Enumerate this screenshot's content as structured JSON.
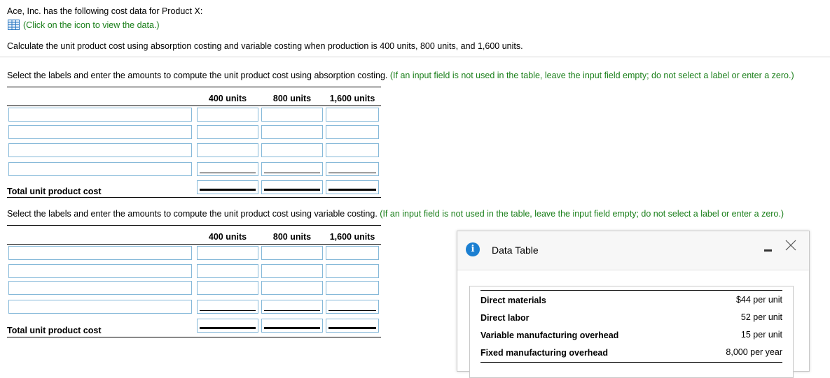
{
  "intro_text": "Ace, Inc. has the following cost data for Product X:",
  "icon_link_text": "(Click on the icon to view the data.)",
  "calc_text": "Calculate the unit product cost using absorption costing and variable costing when production is 400 units, 800 units, and 1,600 units.",
  "absorption": {
    "instruction": "Select the labels and enter the amounts to compute the unit product cost using absorption costing.",
    "note": "(If an input field is not used in the table, leave the input field empty; do not select a label or enter a zero.)",
    "columns": [
      "400 units",
      "800 units",
      "1,600 units"
    ],
    "total_label": "Total unit product cost"
  },
  "variable": {
    "instruction": "Select the labels and enter the amounts to compute the unit product cost using variable costing.",
    "note": "(If an input field is not used in the table, leave the input field empty; do not select a label or enter a zero.)",
    "columns": [
      "400 units",
      "800 units",
      "1,600 units"
    ],
    "total_label": "Total unit product cost"
  },
  "data_table": {
    "title": "Data Table",
    "info_glyph": "i",
    "rows": [
      {
        "label": "Direct materials",
        "value": "$44 per unit"
      },
      {
        "label": "Direct labor",
        "value": "52 per unit"
      },
      {
        "label": "Variable manufacturing overhead",
        "value": "15 per unit"
      },
      {
        "label": "Fixed manufacturing overhead",
        "value": "8,000 per year"
      }
    ]
  },
  "colors": {
    "accent_green": "#1a7f1a",
    "input_border": "#86b9d9",
    "info_blue": "#1b7fd1"
  }
}
